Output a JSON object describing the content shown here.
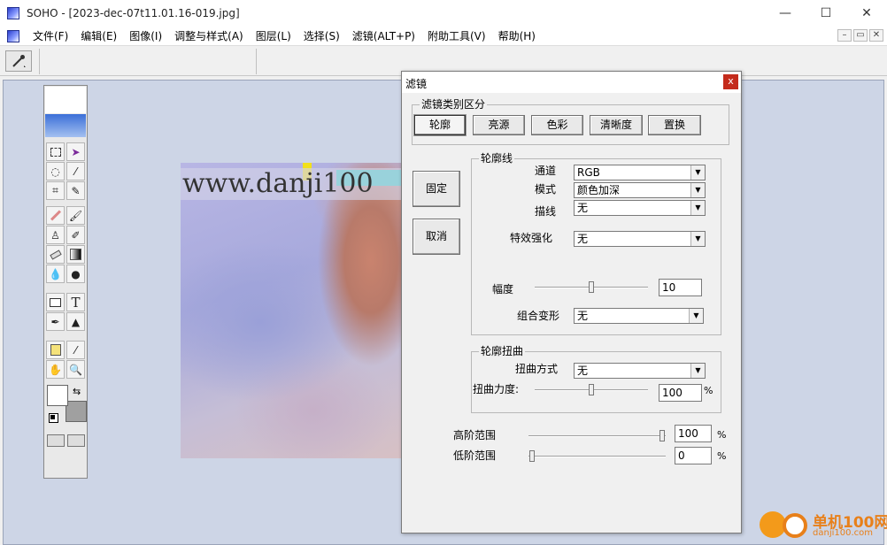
{
  "window": {
    "title": "SOHO - [2023-dec-07t11.01.16-019.jpg]",
    "minimize": "—",
    "maximize": "☐",
    "close": "✕"
  },
  "menu": {
    "items": [
      "文件(F)",
      "编辑(E)",
      "图像(I)",
      "调整与样式(A)",
      "图层(L)",
      "选择(S)",
      "滤镜(ALT+P)",
      "附助工具(V)",
      "帮助(H)"
    ],
    "mdi": [
      "–",
      "▭",
      "✕"
    ]
  },
  "canvas": {
    "watermark": "www.danji100"
  },
  "palette": {
    "tools": [
      "rect-select",
      "move",
      "lasso",
      "magic-wand",
      "crop",
      "eyedropper",
      "pencil",
      "brush",
      "stamp",
      "smudge",
      "eraser",
      "gradient",
      "drop",
      "burn",
      "rectangle",
      "text",
      "pen",
      "arrow",
      "note",
      "picker",
      "hand",
      "zoom"
    ],
    "text_tool_label": "T",
    "swap_label": "⇆"
  },
  "dialog": {
    "title": "滤镜",
    "close": "x",
    "category_group": "滤镜类别区分",
    "category_tabs": [
      "轮廓",
      "亮源",
      "色彩",
      "清晰度",
      "置换"
    ],
    "active_tab": 0,
    "fix_button": "固定",
    "cancel_button": "取消",
    "contour_group": "轮廓线",
    "channel_label": "通道",
    "channel_value": "RGB",
    "mode_label": "模式",
    "mode_value": "颜色加深",
    "stroke_label": "描线",
    "stroke_value": "无",
    "effect_label": "特效强化",
    "effect_value": "无",
    "amplitude_label": "幅度",
    "amplitude_value": "10",
    "amplitude_level": 0.5,
    "combo_label": "组合变形",
    "combo_value": "无",
    "distort_group": "轮廓扭曲",
    "distort_mode_label": "扭曲方式",
    "distort_mode_value": "无",
    "distort_strength_label": "扭曲力度:",
    "distort_strength_value": "100",
    "distort_strength_level": 0.5,
    "high_label": "高阶范围",
    "high_value": "100",
    "high_level": 1.0,
    "low_label": "低阶范围",
    "low_value": "0",
    "low_level": 0.0,
    "percent": "%"
  },
  "logo": {
    "name": "单机100网",
    "url": "danji100.com"
  }
}
